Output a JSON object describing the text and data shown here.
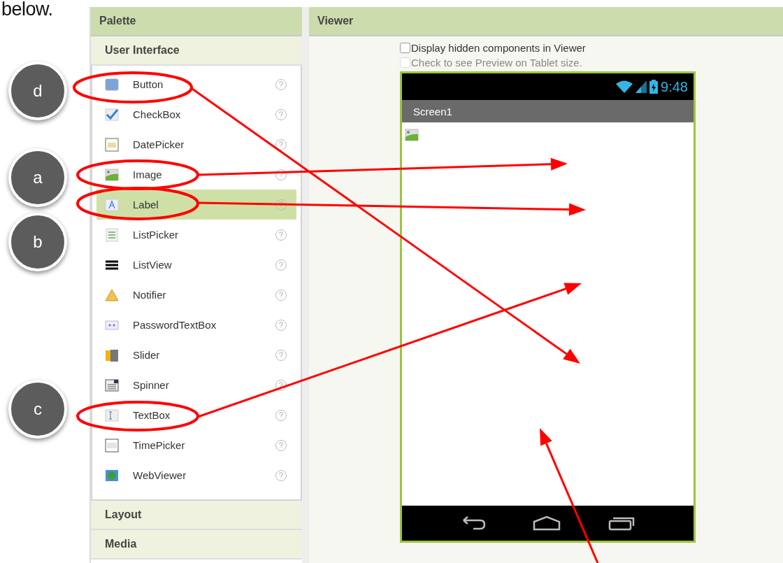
{
  "intro_text": "below.",
  "palette": {
    "title": "Palette",
    "sections": [
      {
        "title": "User Interface",
        "expanded": true,
        "items": [
          {
            "label": "Button",
            "selected": false
          },
          {
            "label": "CheckBox",
            "selected": false
          },
          {
            "label": "DatePicker",
            "selected": false
          },
          {
            "label": "Image",
            "selected": false
          },
          {
            "label": "Label",
            "selected": true
          },
          {
            "label": "ListPicker",
            "selected": false
          },
          {
            "label": "ListView",
            "selected": false
          },
          {
            "label": "Notifier",
            "selected": false
          },
          {
            "label": "PasswordTextBox",
            "selected": false
          },
          {
            "label": "Slider",
            "selected": false
          },
          {
            "label": "Spinner",
            "selected": false
          },
          {
            "label": "TextBox",
            "selected": false
          },
          {
            "label": "TimePicker",
            "selected": false
          },
          {
            "label": "WebViewer",
            "selected": false
          }
        ]
      },
      {
        "title": "Layout",
        "expanded": false
      },
      {
        "title": "Media",
        "expanded": false
      }
    ]
  },
  "viewer": {
    "title": "Viewer",
    "options": [
      {
        "label": "Display hidden components in Viewer",
        "checked": false,
        "disabled": false
      },
      {
        "label": "Check to see Preview on Tablet size.",
        "checked": false,
        "disabled": true
      }
    ],
    "phone": {
      "time": "9:48",
      "screen_title": "Screen1"
    }
  },
  "callouts": [
    {
      "letter": "d"
    },
    {
      "letter": "a"
    },
    {
      "letter": "b"
    },
    {
      "letter": "c"
    }
  ]
}
